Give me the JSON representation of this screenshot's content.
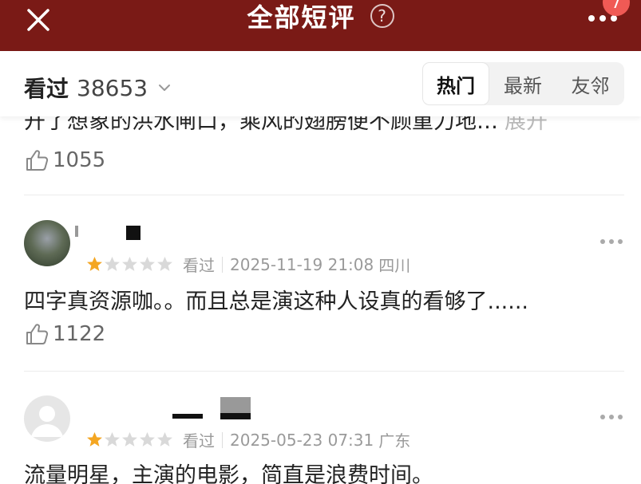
{
  "header": {
    "title": "全部短评",
    "help_symbol": "?",
    "notification_count": "7",
    "bg_color": "#7a1a16"
  },
  "filter": {
    "watched_label": "看过",
    "watched_count": "38653",
    "tabs": [
      {
        "label": "热门",
        "active": true
      },
      {
        "label": "最新",
        "active": false
      },
      {
        "label": "友邻",
        "active": false
      }
    ]
  },
  "partial_review": {
    "text": "开了想象的洪水闸口，乘风的翅膀便不顾重力地…",
    "expand_label": "展开",
    "likes": "1055"
  },
  "reviews": [
    {
      "avatar": "photo",
      "rating": 1,
      "status": "看过",
      "time": "2025-11-19 21:08",
      "location": "四川",
      "text": "四字真资源咖。。而且总是演这种人设真的看够了......",
      "likes": "1122"
    },
    {
      "avatar": "default",
      "rating": 1,
      "status": "看过",
      "time": "2025-05-23 07:31",
      "location": "广东",
      "text": "流量明星，主演的电影，简直是浪费时间。"
    }
  ],
  "colors": {
    "star_on": "#f4a622",
    "star_off": "#d9d9d9"
  }
}
